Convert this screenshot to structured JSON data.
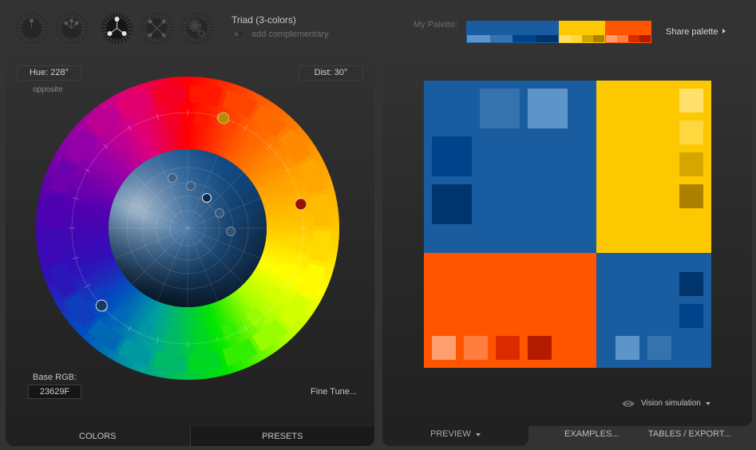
{
  "header": {
    "scheme_modes": [
      {
        "name": "monochromatic",
        "icon": "mono-scheme-icon",
        "active": false
      },
      {
        "name": "analogic",
        "icon": "analogic-scheme-icon",
        "active": false
      },
      {
        "name": "triad",
        "icon": "triad-scheme-icon",
        "active": true
      },
      {
        "name": "tetrad",
        "icon": "tetrad-scheme-icon",
        "active": false
      },
      {
        "name": "custom",
        "icon": "gear-scheme-icon",
        "active": false
      }
    ],
    "scheme_title": "Triad (3-colors)",
    "add_complementary_label": "add complementary",
    "add_complementary_on": false,
    "palette_label": "My Palette:",
    "share_palette_label": "Share palette"
  },
  "palette": [
    {
      "main": "#1A5CA0",
      "shades": [
        "#5E95C8",
        "#3673AE",
        "#00438A",
        "#00346C"
      ]
    },
    {
      "main": "#FCC800",
      "shades": [
        "#FFE06A",
        "#FFD83F",
        "#D6A600",
        "#AD8100"
      ]
    },
    {
      "main": "#FF5500",
      "shades": [
        "#FF9F70",
        "#FF7D3E",
        "#DB2900",
        "#B21B00"
      ]
    }
  ],
  "wheel": {
    "hue_label": "Hue: 228°",
    "dist_label": "Dist: 30°",
    "opposite_label": "opposite",
    "base_rgb_label": "Base RGB:",
    "base_rgb_value": "23629F",
    "fine_tune_label": "Fine Tune...",
    "hue_deg": 228,
    "dist_deg": 30
  },
  "left_tabs": {
    "colors": "COLORS",
    "presets": "PRESETS"
  },
  "right": {
    "vision_simulation_label": "Vision simulation",
    "tabs": {
      "preview": "PREVIEW",
      "examples": "EXAMPLES...",
      "tables": "TABLES / EXPORT..."
    }
  }
}
